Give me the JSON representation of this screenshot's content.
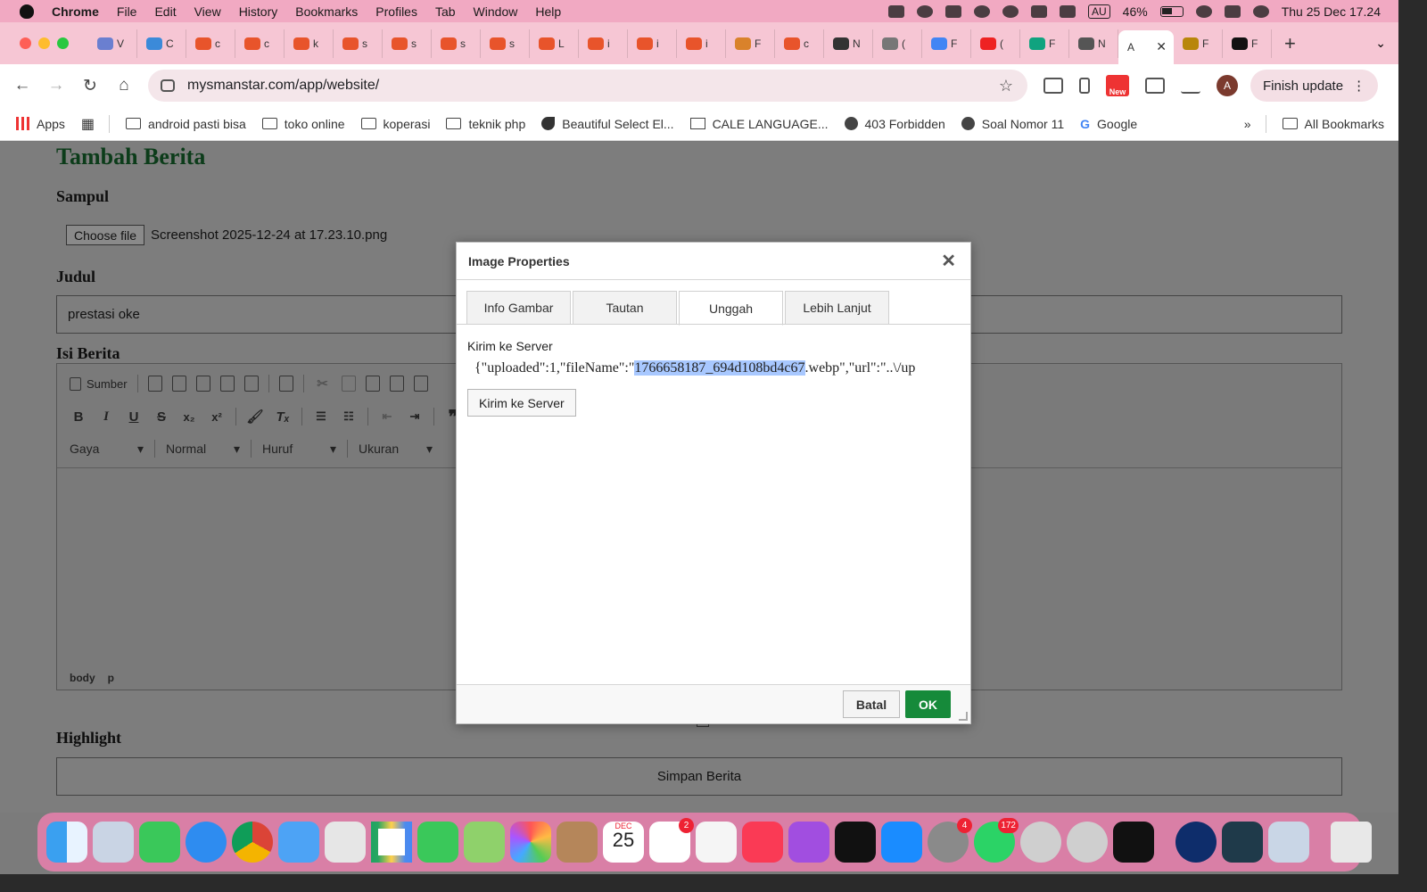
{
  "menubar": {
    "app": "Chrome",
    "items": [
      "File",
      "Edit",
      "View",
      "History",
      "Bookmarks",
      "Profiles",
      "Tab",
      "Window",
      "Help"
    ],
    "keyboard": "AU",
    "battery": "46%",
    "datetime": "Thu 25 Dec  17.24"
  },
  "tabs": {
    "labels": [
      "V",
      "C",
      "c",
      "c",
      "k",
      "s",
      "s",
      "s",
      "s",
      "L",
      "i",
      "i",
      "i",
      "F",
      "c",
      "N",
      "(",
      "F",
      "(",
      "F",
      "N",
      "A",
      "F",
      "F"
    ],
    "active_label": "A"
  },
  "toolbar": {
    "url": "mysmanstar.com/app/website/",
    "new_badge": "New",
    "avatar_letter": "A",
    "finish_update": "Finish update"
  },
  "bookmarks": {
    "apps": "Apps",
    "items": [
      "android pasti bisa",
      "toko online",
      "koperasi",
      "teknik php",
      "Beautiful Select El...",
      "CALE LANGUAGE...",
      "403 Forbidden",
      "Soal Nomor 11",
      "Google"
    ],
    "all": "All Bookmarks"
  },
  "page": {
    "title": "Tambah Berita",
    "cover_label": "Sampul",
    "choose_file": "Choose file",
    "file_name": "Screenshot 2025-12-24 at 17.23.10.png",
    "title_label": "Judul",
    "title_value": "prestasi oke",
    "content_label": "Isi Berita",
    "editor": {
      "source": "Sumber",
      "style": "Gaya",
      "format": "Normal",
      "font": "Huruf",
      "size": "Ukuran",
      "path": [
        "body",
        "p"
      ]
    },
    "highlight_label": "Highlight",
    "save_button": "Simpan Berita"
  },
  "dialog": {
    "title": "Image Properties",
    "tabs": [
      "Info Gambar",
      "Tautan",
      "Unggah",
      "Lebih Lanjut"
    ],
    "active_tab": "Unggah",
    "send_label": "Kirim ke Server",
    "response_prefix": "{\"uploaded\":1,\"fileName\":\"",
    "response_highlight": "1766658187_694d108bd4c67",
    "response_suffix": ".webp\",\"url\":\"..\\/up",
    "send_button": "Kirim ke Server",
    "cancel": "Batal",
    "ok": "OK"
  },
  "dock": {
    "calendar_month": "DEC",
    "calendar_day": "25",
    "badges": {
      "reminders": "2",
      "settings": "4",
      "whatsapp": "172"
    }
  },
  "colors": {
    "menubar": "#f1a9c2",
    "tabbar": "#f6c6d4",
    "overlay_page": "#7d7d7d",
    "heading_green": "#0c3c1a",
    "ok_green": "#168a3a",
    "selection": "#a8c8ff"
  }
}
